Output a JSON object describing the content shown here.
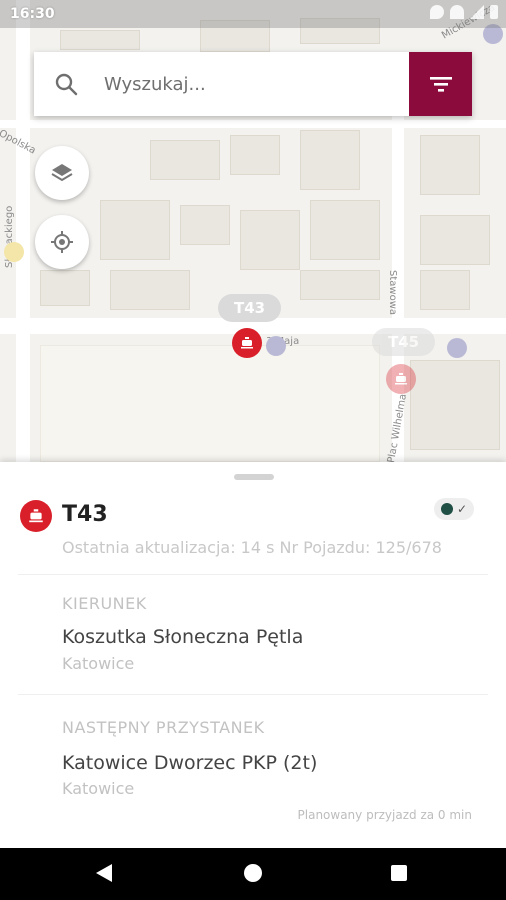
{
  "status_bar": {
    "time": "16:30"
  },
  "search": {
    "placeholder": "Wyszukaj..."
  },
  "map": {
    "street_labels": [
      "Słowackiego",
      "Stawowa",
      "Plac Wilhelma",
      "3 Maja",
      "Opolska",
      "Mickiewicza"
    ],
    "vehicle_tags": [
      "T43",
      "T45"
    ]
  },
  "sheet": {
    "line_name": "T43",
    "last_update": "Ostatnia aktualizacja: 14 s Nr Pojazdu: 125/678",
    "direction": {
      "label": "KIERUNEK",
      "name": "Koszutka Słoneczna Pętla",
      "city": "Katowice"
    },
    "next_stop": {
      "label": "NASTĘPNY PRZYSTANEK",
      "name": "Katowice Dworzec PKP (2t)",
      "city": "Katowice"
    },
    "planned_arrival": "Planowany przyjazd za 0 min"
  },
  "icons": {
    "search": "search-icon",
    "filter": "filter-icon",
    "layers": "layers-icon",
    "locate": "my-location-icon",
    "vehicle": "tram-icon",
    "realtime": "realtime-clock-icon"
  },
  "colors": {
    "accent": "#8b0c3c",
    "vehicle": "#d9202a",
    "realtime": "#1f4f45"
  }
}
